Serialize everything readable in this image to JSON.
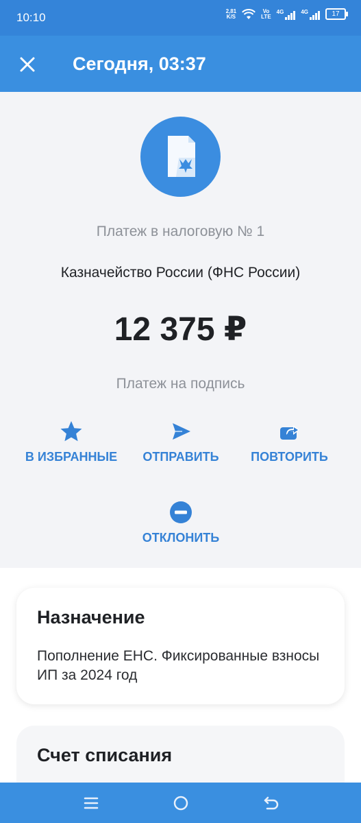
{
  "status_bar": {
    "time": "10:10",
    "net_speed_value": "2,81",
    "net_speed_unit": "K/S",
    "volte_top": "Vo",
    "volte_bottom": "LTE",
    "sim1_label": "4G",
    "sim2_label": "4G",
    "battery": "17"
  },
  "header": {
    "title": "Сегодня, 03:37",
    "close_icon": "close-icon"
  },
  "payment": {
    "icon": "tax-document-icon",
    "type": "Платеж в налоговую № 1",
    "recipient": "Казначейство России (ФНС России)",
    "amount": "12 375 ₽",
    "status": "Платеж на подпись"
  },
  "actions": {
    "favorite": {
      "label": "В ИЗБРАННЫЕ",
      "icon": "star-icon"
    },
    "send": {
      "label": "ОТПРАВИТЬ",
      "icon": "send-icon"
    },
    "repeat": {
      "label": "ПОВТОРИТЬ",
      "icon": "repeat-icon"
    },
    "decline": {
      "label": "ОТКЛОНИТЬ",
      "icon": "minus-circle-icon"
    }
  },
  "cards": {
    "purpose": {
      "title": "Назначение",
      "text": "Пополнение ЕНС. Фиксированные взносы ИП за 2024 год"
    },
    "account": {
      "title": "Счет списания"
    }
  },
  "colors": {
    "primary": "#3a8fe0",
    "accent_text": "#3582d6",
    "background": "#f3f4f7"
  },
  "nav": {
    "menu_icon": "menu-icon",
    "home_icon": "home-circle-icon",
    "back_icon": "back-icon"
  }
}
